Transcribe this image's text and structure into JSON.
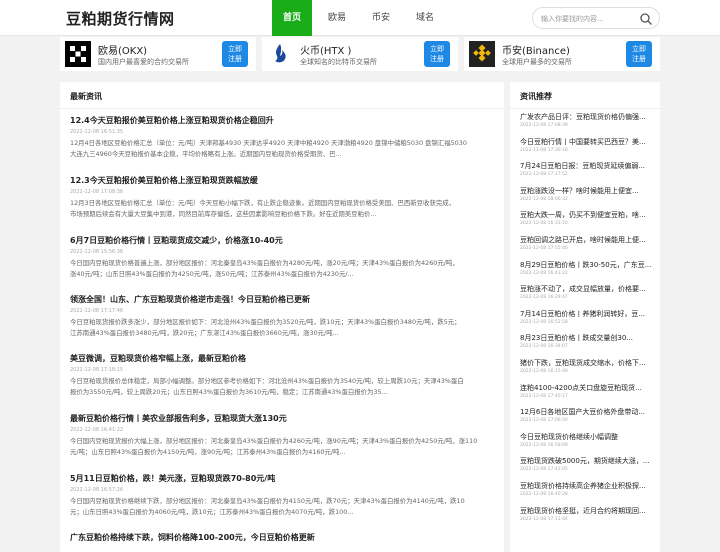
{
  "header": {
    "logo": "豆粕期货行情网",
    "nav": [
      "首页",
      "欧易",
      "币安",
      "域名"
    ],
    "search_placeholder": "输入你要找的内容..."
  },
  "exchanges": [
    {
      "name": "欧易(OKX)",
      "desc": "国内用户最喜爱的合约交易所",
      "btn1": "立即",
      "btn2": "注册",
      "logo": "okx-logo"
    },
    {
      "name": "火币(HTX )",
      "desc": "全球知名的比特币交易所",
      "btn1": "立即",
      "btn2": "注册",
      "logo": "htx-logo"
    },
    {
      "name": "币安(Binance)",
      "desc": "全球用户最多的交易所",
      "btn1": "立即",
      "btn2": "注册",
      "logo": "binance-logo"
    }
  ],
  "main": {
    "title": "最新资讯",
    "articles": [
      {
        "title": "12.4今天豆粕报价美豆粕价格上涨豆粕现货价格企稳回升",
        "date": "2022-12-08 16:51:35",
        "line1": "12月4日各地区豆粕价格汇总（单位：元/吨）天津邦基4930 天津达孚4920 天津中粮4920 天津渤粮4920 盘锦中储粮5030 盘锦汇福5030",
        "line2": "大连九三4960今天豆粕报价基本企稳，平均价格略有上涨。近期国内豆粕现货价格受期货、巴..."
      },
      {
        "title": "12.3今天豆粕报价美豆粕价格上涨豆粕现货跌幅放缓",
        "date": "2022-12-08 17:08:36",
        "line1": "12月3日各地区豆粕价格汇总（单位：元/吨）今天豆粕小幅下跌，有止跌企稳迹象。近期国内豆粕现货价格受美国、巴西新豆收获完成，",
        "line2": "市场预期后续会有大量大豆集中到港，同然目前库存偏低，这些因素影响豆粕价格下跌。好在近期美豆粕价..."
      },
      {
        "title": "6月7日豆粕价格行情丨豆粕现货成交减少，价格涨10-40元",
        "date": "2022-12-08 15:56:36",
        "line1": "今日国内豆粕现货价格普遍上涨，部分地区报价：河北秦皇岛43%蛋白报价为4280元/吨，涨20元/吨；天津43%蛋白报价为4260元/吨，",
        "line2": "涨40元/吨；山东日照43%蛋白报价为4250元/吨，涨50元/吨；江苏泰州43%蛋白报价为4230元/..."
      },
      {
        "title": "领涨全国！山东、广东豆粕现货价格逆市走强！今日豆粕价格已更新",
        "date": "2022-12-08 17:17:46",
        "line1": "今日豆粕现货报价跌多涨少，部分地区报价如下：河北沧州43%蛋白报价为3520元/吨，跌10元；天津43%蛋白报价3480元/吨，跌5元；",
        "line2": "江苏南通43%蛋白报价3480元/吨，跌20元；广东湛江43%蛋白报价3660元/吨，涨30元/吨..."
      },
      {
        "title": "美豆微调，豆粕现货价格窄幅上涨，最新豆粕价格",
        "date": "2022-12-08 17:18:15",
        "line1": "今日豆粕现货报价总体稳定，局部小幅调整。部分地区参考价格如下：河北沧州43%蛋白报价为3540元/吨，较上周跌10元；天津43%蛋白",
        "line2": "报价为3550元/吨，较上周跌20元；山东日照43%蛋白报价为3610元/吨，稳定；江苏南通43%蛋白报价为35..."
      },
      {
        "title": "最新豆粕价格行情丨美农业部报告利多，豆粕现货大涨130元",
        "date": "2022-12-08 16:41:22",
        "line1": "今日国内豆粕现货报价大幅上涨，部分地区报价：河北秦皇岛43%蛋白报价为4260元/吨，涨90元/吨；天津43%蛋白报价为4250元/吨，涨110",
        "line2": "元/吨；山东日照43%蛋白报价为4150元/吨，涨90元/吨；江苏泰州43%蛋白报价为4160元/吨..."
      },
      {
        "title": "5月11日豆粕价格，跌！美元涨，豆粕现货跌70-80元/吨",
        "date": "2022-12-08 16:57:26",
        "line1": "今日国内豆粕现货价格继续下跌，部分地区报价：河北秦皇岛43%蛋白报价为4150元/吨，跌70元；天津43%蛋白报价为4140元/吨，跌10",
        "line2": "元；山东日照43%蛋白报价为4060元/吨，跌10元；江苏泰州43%蛋白报价为4070元/吨，跌100..."
      },
      {
        "title": "广东豆粕价格持续下跌，饲料价格降100-200元，今日豆粕价格更新",
        "date": "",
        "line1": "",
        "line2": ""
      }
    ]
  },
  "sidebar": {
    "title": "资讯推荐",
    "items": [
      {
        "title": "广发农产品日评：豆粕现货价格仍偏强...",
        "date": "2022-12-08 17:08:39"
      },
      {
        "title": "今日豆粕行情丨中国要转买巴西豆？美...",
        "date": "2022-12-08 17:30:18"
      },
      {
        "title": "7月24日豆粕日报：豆粕现货延续偏弱...",
        "date": "2022-12-08 17:17:52"
      },
      {
        "title": "豆粕涨跌没一样？啥时候能用上便宜...",
        "date": "2022-12-08 18:06:32"
      },
      {
        "title": "豆粕大跌一周，仍买不到便宜豆粕，啥...",
        "date": "2022-12-08 16:33:10"
      },
      {
        "title": "豆粕回调之路已开启，啥时候能用上便...",
        "date": "2022-12-08 17:55:40"
      },
      {
        "title": "8月29日豆粕价格丨跌30-50元，广东豆...",
        "date": "2022-12-08 16:43:22"
      },
      {
        "title": "豆粕涨不动了，成交显幅放量，价格要...",
        "date": "2022-12-08 16:29:47"
      },
      {
        "title": "7月14日豆粕价格丨养猪利润转好，豆...",
        "date": "2022-12-08 16:52:58"
      },
      {
        "title": "8月23日豆粕价格丨跌成交量创30...",
        "date": "2022-12-08 16:34:07"
      },
      {
        "title": "猪价下跌，豆粕现货成交缩水，价格下...",
        "date": "2022-12-08 16:15:49"
      },
      {
        "title": "连粕4100-4200点关口盘旋豆粕现货...",
        "date": "2022-12-08 17:40:17"
      },
      {
        "title": "12月6日各地区国产大豆价格外盘带动...",
        "date": "2022-12-08 17:06:50"
      },
      {
        "title": "今日豆粕现货价格继续小幅调整",
        "date": "2022-12-08 16:58:09"
      },
      {
        "title": "豆粕现货跌破5000元，期货继续大涨，...",
        "date": "2022-12-08 17:42:05"
      },
      {
        "title": "豆粕现货价格持续高企养猪企业积极探...",
        "date": "2022-12-08 16:40:28"
      },
      {
        "title": "豆粕现货价格坚挺，近月合约将期现回...",
        "date": "2022-12-08 17:11:44"
      }
    ]
  }
}
